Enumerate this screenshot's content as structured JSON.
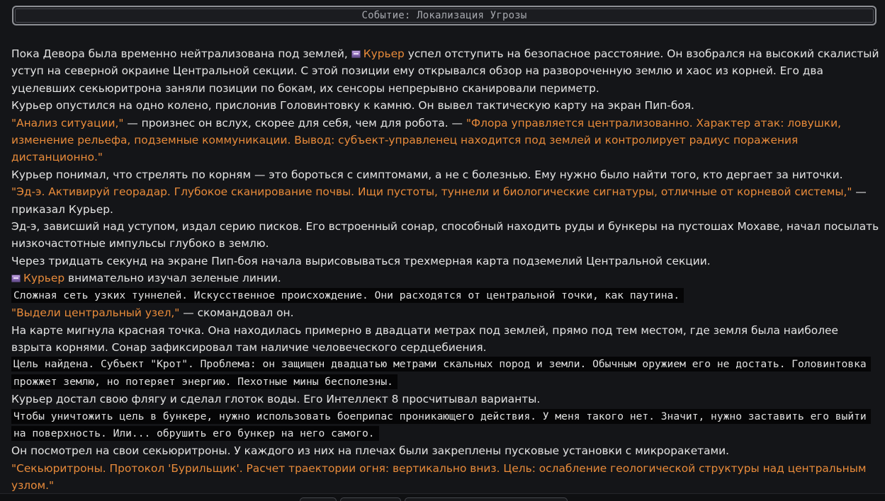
{
  "event": {
    "title": "Событие: Локализация Угрозы"
  },
  "story": {
    "p1": {
      "a": "Пока Девора была временно нейтрализована под землей, ",
      "name": "Курьер",
      "b": " успел отступить на безопасное расстояние. Он взобрался на высокий скалистый уступ на северной окраине Центральной секции. С этой позиции ему открывался обзор на развороченную землю и хаос из корней. Его два уцелевших секьюритрона заняли позиции по бокам, их сенсоры непрерывно сканировали периметр."
    },
    "p2": "Курьер опустился на одно колено, прислонив Головинтовку к камню. Он вывел тактическую карту на экран Пип-боя.",
    "p3": {
      "q1": "\"Анализ ситуации,\"",
      "mid": " — произнес он вслух, скорее для себя, чем для робота. — ",
      "q2": "\"Флора управляется централизованно. Характер атак: ловушки, изменение рельефа, подземные коммуникации. Вывод: субъект-управленец находится под землей и контролирует радиус поражения дистанционно.\""
    },
    "p4": "Курьер понимал, что стрелять по корням — это бороться с симптомами, а не с болезнью. Ему нужно было найти того, кто дергает за ниточки.",
    "p5": {
      "q": "\"Эд-э. Активируй георадар. Глубокое сканирование почвы. Ищи пустоты, туннели и биологические сигнатуры, отличные от корневой системы,\"",
      "rest": " — приказал Курьер."
    },
    "p6": "Эд-э, зависший над уступом, издал серию писков. Его встроенный сонар, способный находить руды и бункеры на пустошах Мохаве, начал посылать низкочастотные импульсы глубоко в землю.",
    "p7": "Через тридцать секунд на экране Пип-боя начала вырисовываться трехмерная карта подземелий Центральной секции.",
    "p8": {
      "name": "Курьер",
      "rest": " внимательно изучал зеленые линии."
    },
    "c1": "Сложная сеть узких туннелей. Искусственное происхождение. Они расходятся от центральной точки, как паутина.",
    "p9": {
      "q": "\"Выдели центральный узел,\"",
      "rest": " — скомандовал он."
    },
    "p10": "На карте мигнула красная точка. Она находилась примерно в двадцати метрах под землей, прямо под тем местом, где земля была наиболее взрыта корнями. Сонар зафиксировал там наличие человеческого сердцебиения.",
    "c2": "Цель найдена. Субъект \"Крот\". Проблема: он защищен двадцатью метрами скальных пород и земли. Обычным оружием его не достать. Головинтовка прожжет землю, но потеряет энергию. Пехотные мины бесполезны.",
    "p11": "Курьер достал свою флягу и сделал глоток воды. Его Интеллект 8 просчитывал варианты.",
    "c3": "Чтобы уничтожить цель в бункере, нужно использовать боеприпас проникающего действия. У меня такого нет. Значит, нужно заставить его выйти на поверхность. Или... обрушить его бункер на него самого.",
    "p12": "Он посмотрел на свои секьюритроны. У каждого из них на плечах были закреплены пусковые установки с микроракетами.",
    "p13": "\"Секьюритроны. Протокол 'Бурильщик'. Расчет траектории огня: вертикально вниз. Цель: ослабление геологической структуры над центральным узлом.\""
  },
  "icons": {
    "courier": "robot-chip-icon"
  },
  "colors": {
    "background": "#141518",
    "text": "#e4e4e4",
    "speech": "#e98b3a",
    "code_bg": "#050506",
    "banner_border": "#8d8f94"
  }
}
